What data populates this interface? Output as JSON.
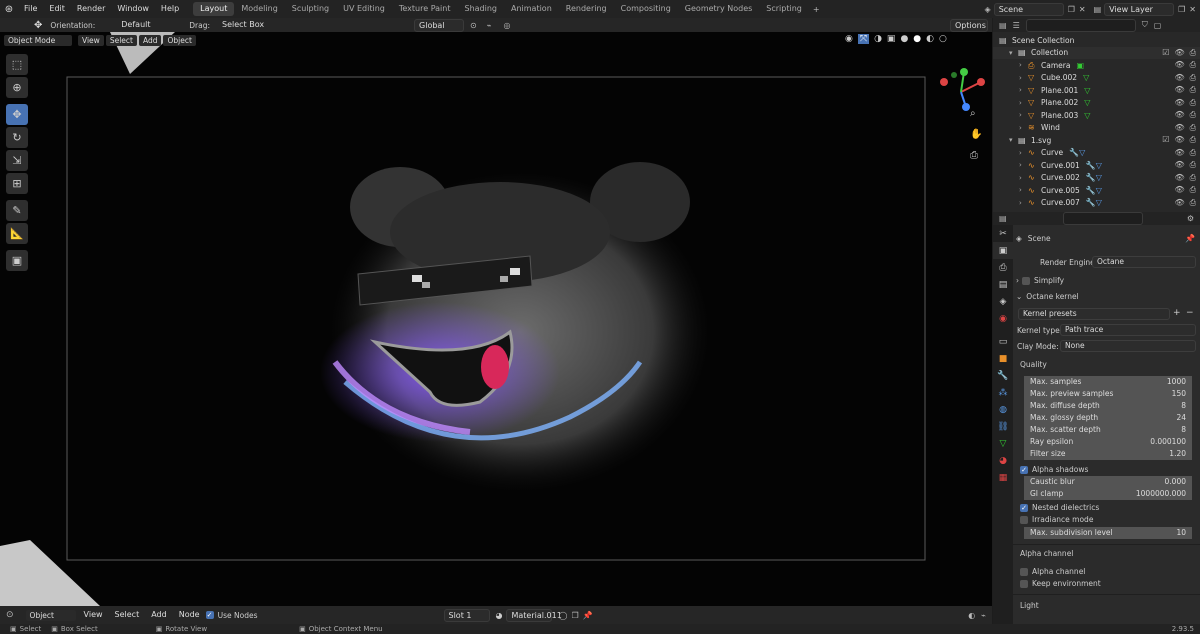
{
  "topbar": {
    "menus": [
      "File",
      "Edit",
      "Render",
      "Window",
      "Help"
    ],
    "workspaces": [
      "Layout",
      "Modeling",
      "Sculpting",
      "UV Editing",
      "Texture Paint",
      "Shading",
      "Animation",
      "Rendering",
      "Compositing",
      "Geometry Nodes",
      "Scripting"
    ],
    "active_workspace": "Layout",
    "scene": "Scene",
    "view_layer": "View Layer"
  },
  "toolhdr": {
    "orientation_label": "Orientation:",
    "orientation_value": "Default",
    "drag_label": "Drag:",
    "drag_value": "Select Box",
    "transform_value": "Global",
    "options_label": "Options"
  },
  "viewhdr": {
    "mode": "Object Mode",
    "menus": [
      "View",
      "Select",
      "Add",
      "Object"
    ]
  },
  "outliner": {
    "root": "Scene Collection",
    "rows": [
      {
        "name": "Collection",
        "type": "collection",
        "indent": 1
      },
      {
        "name": "Camera",
        "type": "camera",
        "indent": 2
      },
      {
        "name": "Cube.002",
        "type": "mesh",
        "indent": 2
      },
      {
        "name": "Plane.001",
        "type": "mesh",
        "indent": 2
      },
      {
        "name": "Plane.002",
        "type": "mesh",
        "indent": 2
      },
      {
        "name": "Plane.003",
        "type": "mesh",
        "indent": 2
      },
      {
        "name": "Wind",
        "type": "force",
        "indent": 2
      },
      {
        "name": "1.svg",
        "type": "collection",
        "indent": 1
      },
      {
        "name": "Curve",
        "type": "curve",
        "indent": 2
      },
      {
        "name": "Curve.001",
        "type": "curve",
        "indent": 2
      },
      {
        "name": "Curve.002",
        "type": "curve",
        "indent": 2
      },
      {
        "name": "Curve.005",
        "type": "curve",
        "indent": 2
      },
      {
        "name": "Curve.007",
        "type": "curve",
        "indent": 2
      }
    ]
  },
  "props": {
    "context": "Scene",
    "render_engine_label": "Render Engine",
    "render_engine": "Octane",
    "simplify": "Simplify",
    "octane_kernel": "Octane kernel",
    "kernel_presets": "Kernel presets",
    "kernel_type_label": "Kernel type:",
    "kernel_type": "Path trace",
    "clay_mode_label": "Clay Mode:",
    "clay_mode": "None",
    "quality": "Quality",
    "fields": [
      {
        "label": "Max. samples",
        "value": "1000"
      },
      {
        "label": "Max. preview samples",
        "value": "150"
      },
      {
        "label": "Max. diffuse depth",
        "value": "8"
      },
      {
        "label": "Max. glossy depth",
        "value": "24"
      },
      {
        "label": "Max. scatter depth",
        "value": "8"
      },
      {
        "label": "Ray epsilon",
        "value": "0.000100"
      },
      {
        "label": "Filter size",
        "value": "1.20"
      }
    ],
    "alpha_shadows": "Alpha shadows",
    "fields2": [
      {
        "label": "Caustic blur",
        "value": "0.000"
      },
      {
        "label": "GI clamp",
        "value": "1000000.000"
      }
    ],
    "nested_dielectrics": "Nested dielectrics",
    "irradiance_mode": "Irradiance mode",
    "max_subdiv_label": "Max. subdivision level",
    "max_subdiv_value": "10",
    "alpha_channel_header": "Alpha channel",
    "alpha_channel": "Alpha channel",
    "keep_environment": "Keep environment",
    "light_header": "Light"
  },
  "botbar": {
    "mode": "Object",
    "menus": [
      "View",
      "Select",
      "Add",
      "Node"
    ],
    "use_nodes": "Use Nodes",
    "slot": "Slot 1",
    "material": "Material.011"
  },
  "statusbar": {
    "select": "Select",
    "box_select": "Box Select",
    "rotate_view": "Rotate View",
    "context_menu": "Object Context Menu",
    "version": "2.93.5"
  }
}
